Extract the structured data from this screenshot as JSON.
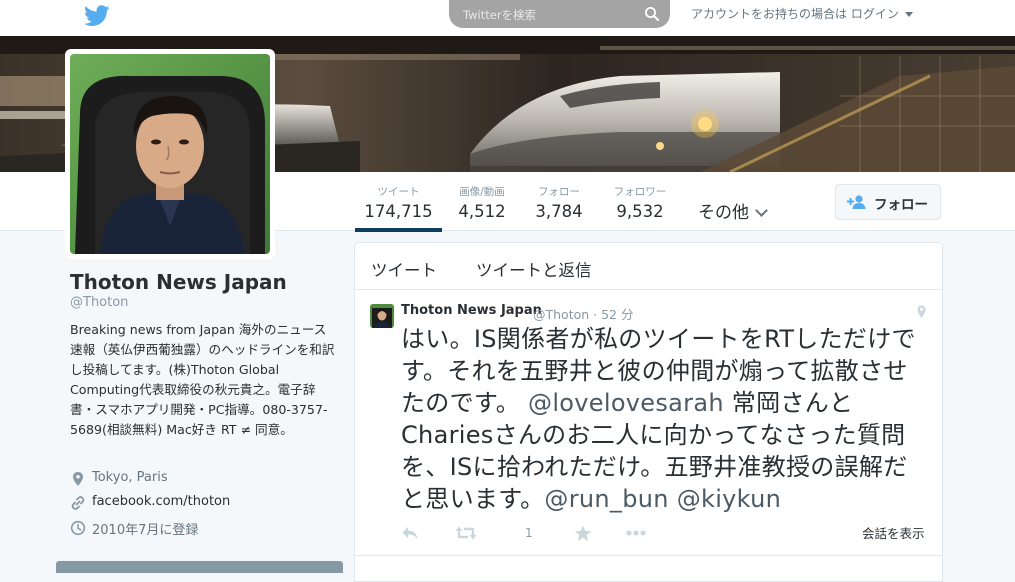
{
  "topbar": {
    "logo_icon": "twitter-bird-icon",
    "search_placeholder": "Twitterを検索",
    "search_icon": "search-icon",
    "login_text": "アカウントをお持ちの場合は ログイン"
  },
  "profile_nav": {
    "stats": [
      {
        "label": "ツイート",
        "value": "174,715",
        "active": true
      },
      {
        "label": "画像/動画",
        "value": "4,512"
      },
      {
        "label": "フォロー",
        "value": "3,784"
      },
      {
        "label": "フォロワー",
        "value": "9,532"
      }
    ],
    "more_label": "その他",
    "follow_label": "フォロー"
  },
  "profile": {
    "name": "Thoton News Japan",
    "handle": "@Thoton",
    "bio": "Breaking news from Japan 海外のニュース速報（英仏伊西葡独露）のヘッドラインを和訳し投稿してます。(株)Thoton Global Computing代表取締役の秋元貴之。電子辞書・スマホアプリ開発・PC指導。080-3757-5689(相談無料) Mac好き RT ≠ 同意。",
    "location": "Tokyo, Paris",
    "url": "facebook.com/thoton",
    "joined": "2010年7月に登録"
  },
  "timeline": {
    "tabs": [
      "ツイート",
      "ツイートと返信"
    ],
    "tweet": {
      "author": "Thoton News Japan",
      "handle_time": "@Thoton · 52 分",
      "text_main": "はい。IS関係者が私のツイートをRTしただけです。それを五野井と彼の仲間が煽って拡散させたのです。 ",
      "mention1": "@lovelovesarah",
      "text_mid": " 常岡さんとChariesさんのお二人に向かってなさった質問を、ISに拾われただけ。五野井准教授の誤解だと思います。",
      "mention2": "@run_bun",
      "mention3": "@kiykun",
      "retweet_count": "1",
      "conversation_label": "会話を表示"
    }
  },
  "colors": {
    "accent": "#0e3f5b",
    "muted": "#8899a6",
    "text": "#292f33",
    "twitter_blue": "#55acee"
  }
}
